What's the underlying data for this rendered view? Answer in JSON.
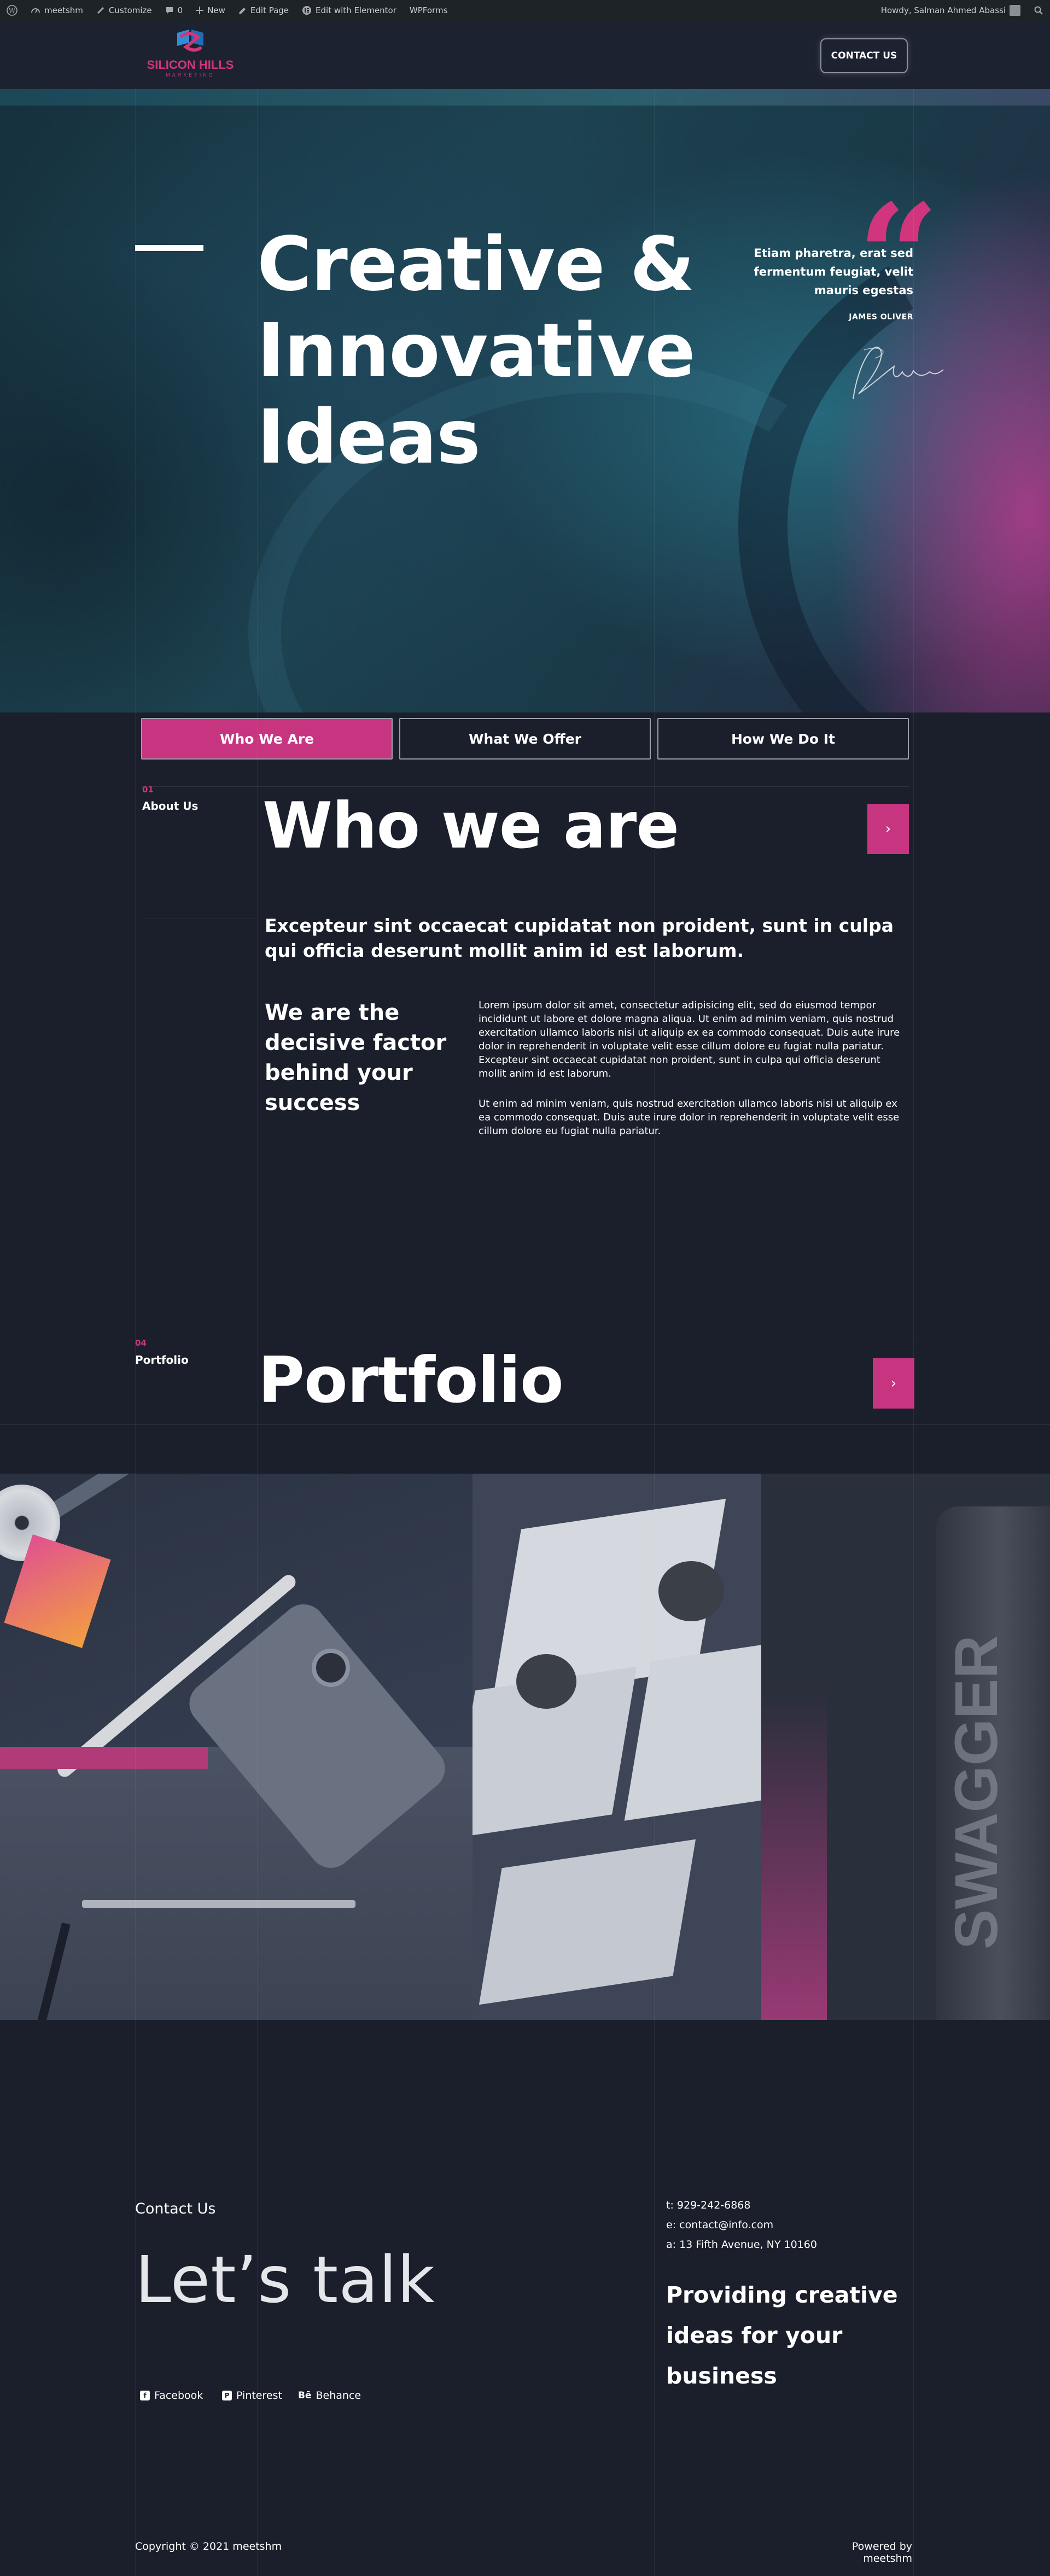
{
  "admin_bar": {
    "site_name": "meetshm",
    "customize": "Customize",
    "comments_count": "0",
    "new": "New",
    "edit_page": "Edit Page",
    "edit_elementor": "Edit with Elementor",
    "wpforms": "WPForms",
    "howdy": "Howdy, Salman Ahmed Abassi"
  },
  "header": {
    "logo_line1": "SILICON HILLS",
    "logo_line2": "MARKETING",
    "contact_button": "CONTACT US"
  },
  "hero": {
    "title_line1": "Creative &",
    "title_line2": "Innovative",
    "title_line3": "Ideas",
    "quote_line1": "Etiam pharetra, erat sed",
    "quote_line2": "fermentum feugiat, velit",
    "quote_line3": "mauris egestas",
    "quote_author": "JAMES OLIVER"
  },
  "tabs": [
    "Who We Are",
    "What We Offer",
    "How We Do It"
  ],
  "about": {
    "number": "01",
    "label": "About Us",
    "heading": "Who we are",
    "lead": "Excepteur sint occaecat cupidatat non proident, sunt in culpa qui officia deserunt mollit anim id est laborum.",
    "subheading": "We are the decisive factor behind your success",
    "paragraph1": "Lorem ipsum dolor sit amet, consectetur adipisicing elit, sed do eiusmod tempor incididunt ut labore et dolore magna aliqua. Ut enim ad minim veniam, quis nostrud exercitation ullamco laboris nisi ut aliquip ex ea commodo consequat. Duis aute irure dolor in reprehenderit in voluptate velit esse cillum dolore eu fugiat nulla pariatur. Excepteur sint occaecat cupidatat non proident, sunt in culpa qui officia deserunt mollit anim id est laborum.",
    "paragraph2": "Ut enim ad minim veniam, quis nostrud exercitation ullamco laboris nisi ut aliquip ex ea commodo consequat. Duis aute irure dolor in reprehenderit in voluptate velit esse cillum dolore eu fugiat nulla pariatur."
  },
  "portfolio": {
    "number": "04",
    "label": "Portfolio",
    "heading": "Portfolio",
    "image3_text": "SWAGGER"
  },
  "contact": {
    "label": "Contact Us",
    "heading": "Let’s talk",
    "phone": "t: 929-242-6868",
    "email": "e: contact@info.com",
    "address": "a: 13 Fifth Avenue, NY 10160",
    "tagline": "Providing creative ideas for your business",
    "social": {
      "facebook": "Facebook",
      "pinterest": "Pinterest",
      "behance": "Behance"
    }
  },
  "footer": {
    "copyright": "Copyright © 2021 meetshm",
    "powered": "Powered by meetshm"
  },
  "colors": {
    "accent": "#c73580",
    "background": "#1b1f2b",
    "admin_bar": "#1d2327"
  }
}
